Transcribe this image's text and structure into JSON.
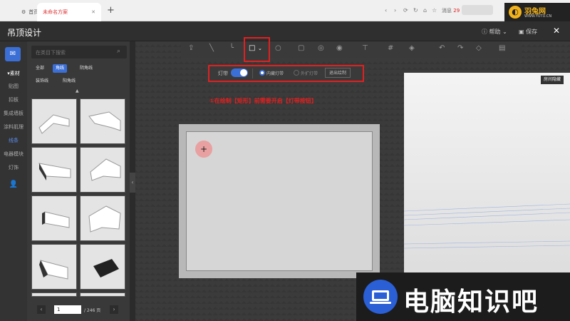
{
  "browser": {
    "tab_home": "首页",
    "tab_project": "未命名方案",
    "new_tab": "+",
    "nav_icons": [
      "back-icon",
      "forward-icon",
      "refresh-icon",
      "refresh-alt-icon",
      "home-icon",
      "star-icon"
    ],
    "message_label": "消息",
    "message_count": "29"
  },
  "watermark_top": {
    "brand": "羽兔网",
    "url": "WWW.YUTU.CN"
  },
  "titlebar": {
    "title": "吊顶设计",
    "help_label": "帮助",
    "save_label": "保存",
    "close": "✕"
  },
  "rail": {
    "items": [
      "素材",
      "贴图",
      "扣板",
      "集成墙板",
      "涂料肌理",
      "线条",
      "电器模块",
      "灯饰"
    ]
  },
  "panel": {
    "search_placeholder": "在类目下搜索",
    "chips_row1": [
      "全部",
      "角线",
      "阴角线"
    ],
    "chips_row2": [
      "装饰线",
      "阳角线"
    ],
    "selected_chip": "角线",
    "page_current": "1",
    "page_total": "/ 246 页",
    "prev": "‹",
    "next": "›",
    "collapse": "‹"
  },
  "strip": {
    "light_label": "灯带",
    "inner_label": "内藏灯带",
    "outer_label": "外扩灯带",
    "exit_label": "退出绘制"
  },
  "annotation": "①在绘制【矩形】前需要开启【灯带按钮】",
  "view3d_label": "房间隐藏",
  "cursor_symbol": "+",
  "watermark_bottom": "电脑知识吧",
  "colors": {
    "accent": "#3c6fd6",
    "highlight": "#e02020"
  }
}
